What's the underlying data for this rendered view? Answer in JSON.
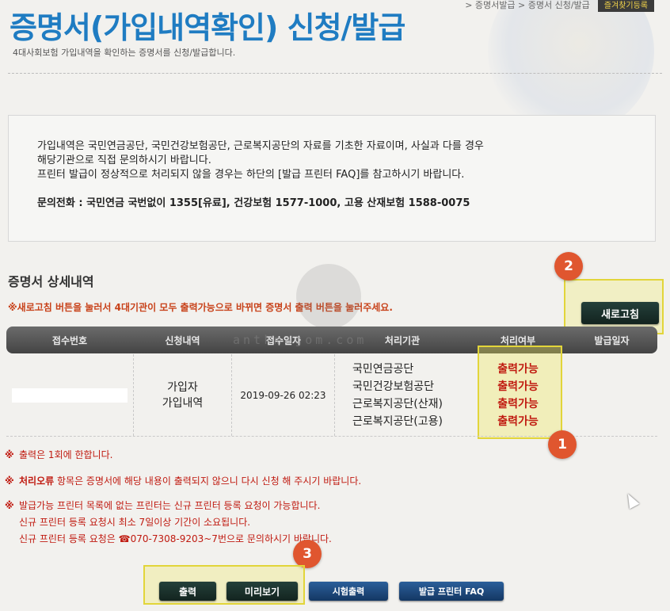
{
  "header": {
    "title": "증명서(가입내역확인) 신청/발급",
    "subtitle": "4대사회보험 가입내역을 확인하는 증명서를 신청/발급합니다.",
    "breadcrumb": "> 증명서발급 > 증명서 신청/발급",
    "favorite_label": "즐겨찾기등록"
  },
  "notice": {
    "line1": "가입내역은 국민연금공단, 국민건강보험공단, 근로복지공단의 자료를 기초한 자료이며, 사실과 다를 경우",
    "line2": "해당기관으로 직접 문의하시기 바랍니다.",
    "line3": "프린터 발급이 정상적으로 처리되지 않을 경우는 하단의 [발급 프린터 FAQ]를 참고하시기 바랍니다.",
    "contact": "문의전화 : 국민연금 국번없이 1355[유료], 건강보험 1577-1000, 고용 산재보험 1588-0075"
  },
  "details": {
    "section_title": "증명서 상세내역",
    "refresh_note": "※새로고침 버튼을 눌러서 4대기관이 모두 출력가능으로 바뀌면 증명서 출력 버튼을 눌러주세요.",
    "refresh_button": "새로고침"
  },
  "table": {
    "headers": [
      "접수번호",
      "신청내역",
      "접수일자",
      "처리기관",
      "처리여부",
      "발급일자"
    ],
    "row": {
      "request_type_line1": "가입자",
      "request_type_line2": "가입내역",
      "received_date": "2019-09-26 02:23",
      "agencies": [
        "국민연금공단",
        "국민건강보험공단",
        "근로복지공단(산재)",
        "근로복지공단(고용)"
      ],
      "statuses": [
        "출력가능",
        "출력가능",
        "출력가능",
        "출력가능"
      ],
      "issue_date": ""
    }
  },
  "notes": {
    "mark": "※",
    "note1": "출력은 1회에 한합니다.",
    "note2_bold": "처리오류",
    "note2_rest": " 항목은 증명서에 해당 내용이 출력되지 않으니 다시 신청 해 주시기 바랍니다.",
    "note3_line1": "발급가능 프린터 목록에 없는 프린터는 신규 프린터 등록 요청이 가능합니다.",
    "note3_line2": "신규 프린터 등록 요청시 최소 7일이상 기간이 소요됩니다.",
    "note3_line3": "신규 프린터 등록 요청은 ☎070-7308-9203~7번으로 문의하시기 바랍니다."
  },
  "actions": {
    "print": "출력",
    "preview": "미리보기",
    "test_print": "시험출력",
    "printer_faq": "발급 프린터 FAQ"
  },
  "annotations": {
    "badge1": "1",
    "badge2": "2",
    "badge3": "3"
  },
  "watermark": "antkmagom.com",
  "colors": {
    "title_blue": "#1f7cc2",
    "status_red": "#c01a10",
    "badge_orange": "#e0562f",
    "highlight_yellow": "#e2d53a"
  }
}
